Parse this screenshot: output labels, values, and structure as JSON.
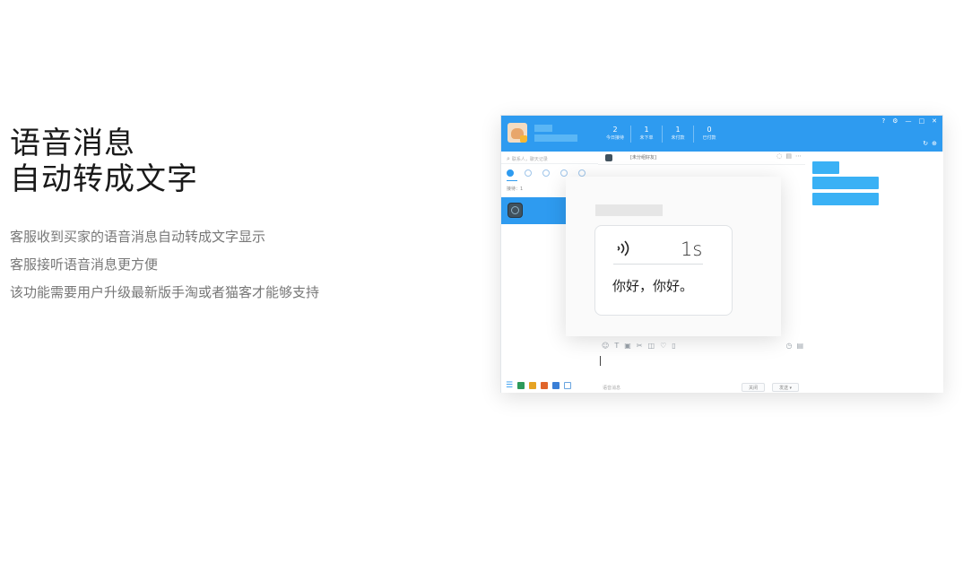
{
  "headline": {
    "line1": "语音消息",
    "line2": "自动转成文字"
  },
  "description": [
    "客服收到买家的语音消息自动转成文字显示",
    "客服接听语音消息更方便",
    "该功能需要用户升级最新版手淘或者猫客才能够支持"
  ],
  "app": {
    "stats": [
      {
        "value": "2",
        "label": "今日接待"
      },
      {
        "value": "1",
        "label": "未下单"
      },
      {
        "value": "1",
        "label": "未付款"
      },
      {
        "value": "0",
        "label": "已付款"
      }
    ],
    "window_controls": {
      "help": "?",
      "minimize": "—",
      "maximize": "□",
      "close": "✕"
    },
    "search_placeholder": "联系人，聊天记录",
    "receiving_label": "接待：1",
    "chat_title": "[未分组好友]",
    "input_hint": "语音消息",
    "close_button": "关闭",
    "send_button": "发送 ▾"
  },
  "popup": {
    "duration": "1s",
    "text": "你好，你好。"
  },
  "colors": {
    "accent": "#2e9bf0",
    "right_blocks": "#3ab1f5"
  }
}
